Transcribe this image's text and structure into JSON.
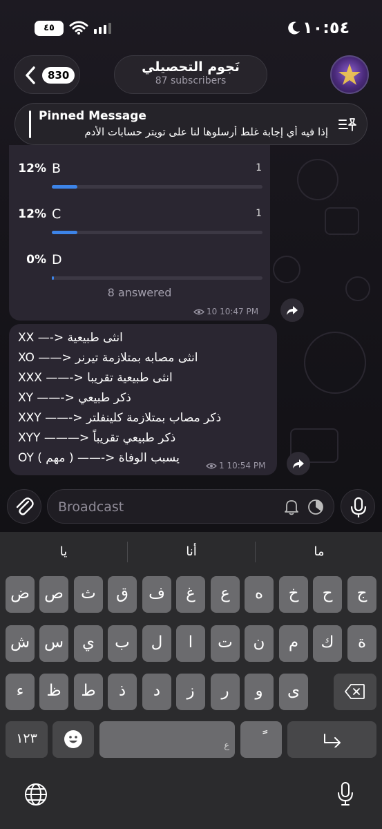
{
  "status_bar": {
    "time": "١٠:٥٤",
    "battery": "٤٥"
  },
  "header": {
    "back_count": "830",
    "channel_name": "نَجوم التحصيلي",
    "subscribers": "87 subscribers"
  },
  "pinned": {
    "title": "Pinned Message",
    "text": "إذا فيه أي إجابة غلط أرسلوها لنا على تويتر حسابات الأدم"
  },
  "poll": {
    "options": [
      {
        "percent": "12%",
        "label": "B",
        "count": "1",
        "fill": 0.12
      },
      {
        "percent": "12%",
        "label": "C",
        "count": "1",
        "fill": 0.12
      },
      {
        "percent": "0%",
        "label": "D",
        "count": "",
        "fill": 0.01
      }
    ],
    "answered": "8 answered",
    "views": "10",
    "time": "10:47 PM"
  },
  "message": {
    "lines": [
      "XX —-> انثى طبيعية",
      "XO ——> انثى مصابه بمتلازمة تيرنر",
      "XXX ——-> انثى طبيعية تقريبا",
      "XY ——-> ذكر طبيعي",
      "XXY ——-> ذكر مصاب بمتلازمة كلينفلتر",
      "XYY ———> ذكر طبيعي تقريباً",
      "OY ( مهم ) ——-> يسبب الوفاة"
    ],
    "views": "1",
    "time": "10:54 PM"
  },
  "input": {
    "placeholder": "Broadcast"
  },
  "keyboard": {
    "suggestions": [
      "يا",
      "أنا",
      "ما"
    ],
    "row1": [
      "ض",
      "ص",
      "ث",
      "ق",
      "ف",
      "غ",
      "ع",
      "ه",
      "خ",
      "ح",
      "ج"
    ],
    "row2": [
      "ش",
      "س",
      "ي",
      "ب",
      "ل",
      "ا",
      "ت",
      "ن",
      "م",
      "ك",
      "ة"
    ],
    "row3": [
      "ء",
      "ظ",
      "ط",
      "ذ",
      "د",
      "ز",
      "ر",
      "و",
      "ى"
    ],
    "numbers_key": "١٢٣",
    "space_hint": "ع",
    "tanween_key": "ً"
  }
}
